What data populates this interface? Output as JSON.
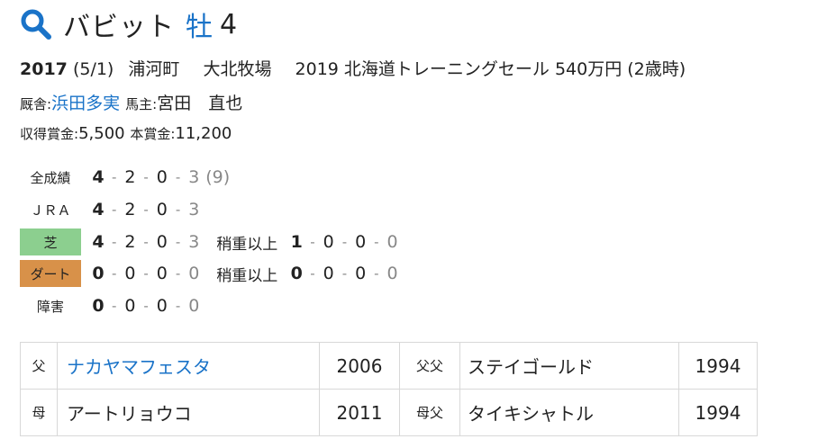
{
  "horse": {
    "name": "バビット",
    "sex": "牡",
    "age": "4"
  },
  "profile": {
    "birth_year": "2017",
    "birth_date": "(5/1)",
    "region": "浦河町",
    "breeder": "大北牧場",
    "sale": "2019 北海道トレーニングセール 540万円 (2歳時)",
    "trainer_label": "厩舎:",
    "trainer": "浜田多実",
    "owner_label": "馬主:",
    "owner": "宮田　直也",
    "earnings_label": "収得賞金:",
    "earnings": "5,500",
    "prize_label": "本賞金:",
    "prize": "11,200"
  },
  "records": {
    "all": {
      "label": "全成績",
      "values": [
        "4",
        "2",
        "0",
        "3"
      ],
      "extra": "(9)"
    },
    "jra": {
      "label": "ＪＲＡ",
      "values": [
        "4",
        "2",
        "0",
        "3"
      ]
    },
    "turf": {
      "label": "芝",
      "values": [
        "4",
        "2",
        "0",
        "3"
      ],
      "sub_label": "稍重以上",
      "sub_values": [
        "1",
        "0",
        "0",
        "0"
      ]
    },
    "dirt": {
      "label": "ダート",
      "values": [
        "0",
        "0",
        "0",
        "0"
      ],
      "sub_label": "稍重以上",
      "sub_values": [
        "0",
        "0",
        "0",
        "0"
      ]
    },
    "jump": {
      "label": "障害",
      "values": [
        "0",
        "0",
        "0",
        "0"
      ]
    }
  },
  "pedigree": {
    "sire_label": "父",
    "sire": "ナカヤマフェスタ",
    "sire_year": "2006",
    "sire_sire_label": "父父",
    "sire_sire": "ステイゴールド",
    "sire_sire_year": "1994",
    "dam_label": "母",
    "dam": "アートリョウコ",
    "dam_year": "2011",
    "dam_sire_label": "母父",
    "dam_sire": "タイキシャトル",
    "dam_sire_year": "1994"
  },
  "colors": {
    "accent": "#1a73c8",
    "turf": "#8ccf8f",
    "dirt": "#d89149"
  },
  "icons": {
    "search": "search-icon"
  }
}
